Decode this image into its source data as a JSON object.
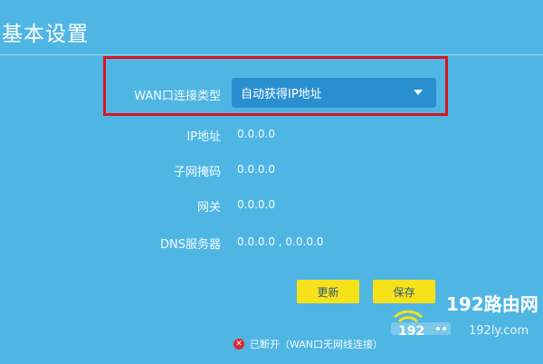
{
  "page": {
    "title": "基本设置"
  },
  "form": {
    "wan_type_label": "WAN口连接类型",
    "wan_type_value": "自动获得IP地址",
    "fields": [
      {
        "label": "IP地址",
        "value": "0.0.0.0"
      },
      {
        "label": "子网掩码",
        "value": "0.0.0.0"
      },
      {
        "label": "网关",
        "value": "0.0.0.0"
      },
      {
        "label": "DNS服务器",
        "value": "0.0.0.0 , 0.0.0.0"
      }
    ]
  },
  "buttons": {
    "refresh": "更新",
    "save": "保存"
  },
  "status": {
    "text": "已断开（WAN口无网线连接）",
    "icon": "close-icon"
  },
  "watermark": {
    "brand": "192路由网",
    "domain": "192ly.com",
    "badge": "192"
  },
  "colors": {
    "background": "#4fb6e4",
    "select": "#2a8fd0",
    "button": "#f7e11b",
    "highlight": "#d8151f"
  }
}
